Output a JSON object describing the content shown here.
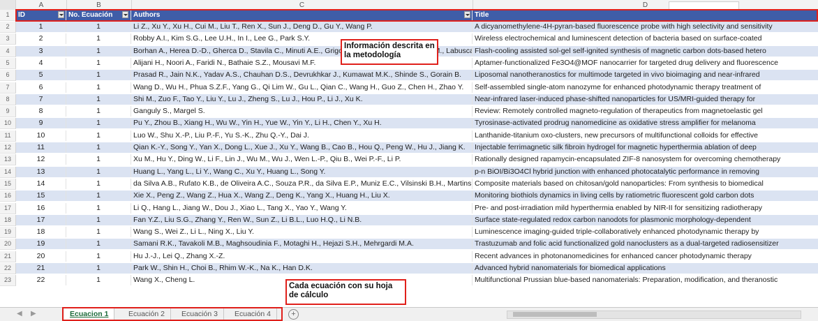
{
  "column_letters": [
    "A",
    "B",
    "C",
    "D"
  ],
  "name_box": "",
  "header": {
    "id": "ID",
    "no_ecuacion": "No. Ecuación",
    "authors": "Authors",
    "title": "Title"
  },
  "rows": [
    {
      "n": "2",
      "id": "1",
      "ne": "1",
      "authors": "Li Z., Xu Y., Xu H., Cui M., Liu T., Ren X., Sun J., Deng D., Gu Y., Wang P.",
      "title": "A dicyanomethylene-4H-pyran-based fluorescence probe with high selectivity and sensitivity"
    },
    {
      "n": "3",
      "id": "2",
      "ne": "1",
      "authors": "Robby A.I., Kim S.G., Lee U.H., In I., Lee G., Park S.Y.",
      "title": "Wireless electrochemical and luminescent detection of bacteria based on surface-coated"
    },
    {
      "n": "4",
      "id": "3",
      "ne": "1",
      "authors": "Borhan A., Herea D.-D., Gherca D., Stavila C., Minuti A.E., Grigoras M., Lupu N., Labusca C.M., Labusca L.",
      "title": "Flash-cooling assisted sol-gel self-ignited synthesis of magnetic carbon dots-based hetero"
    },
    {
      "n": "5",
      "id": "4",
      "ne": "1",
      "authors": "Alijani H., Noori A., Faridi N., Bathaie S.Z., Mousavi M.F.",
      "title": "Aptamer-functionalized Fe3O4@MOF nanocarrier for targeted drug delivery and fluorescence"
    },
    {
      "n": "6",
      "id": "5",
      "ne": "1",
      "authors": "Prasad R., Jain N.K., Yadav A.S., Chauhan D.S., Devrukhkar J., Kumawat M.K., Shinde S., Gorain B.",
      "title": "Liposomal nanotheranostics for multimode targeted in vivo bioimaging and near-infrared"
    },
    {
      "n": "7",
      "id": "6",
      "ne": "1",
      "authors": "Wang D., Wu H., Phua S.Z.F., Yang G., Qi Lim W., Gu L., Qian C., Wang H., Guo Z., Chen H., Zhao Y.",
      "title": "Self-assembled single-atom nanozyme for enhanced photodynamic therapy treatment of"
    },
    {
      "n": "8",
      "id": "7",
      "ne": "1",
      "authors": "Shi M., Zuo F., Tao Y., Liu Y., Lu J., Zheng S., Lu J., Hou P., Li J., Xu K.",
      "title": "Near-infrared laser-induced phase-shifted nanoparticles for US/MRI-guided therapy for"
    },
    {
      "n": "9",
      "id": "8",
      "ne": "1",
      "authors": "Ganguly S., Margel S.",
      "title": "Review: Remotely controlled magneto-regulation of therapeutics from magnetoelastic gel"
    },
    {
      "n": "10",
      "id": "9",
      "ne": "1",
      "authors": "Pu Y., Zhou B., Xiang H., Wu W., Yin H., Yue W., Yin Y., Li H., Chen Y., Xu H.",
      "title": "Tyrosinase-activated prodrug nanomedicine as oxidative stress amplifier for melanoma"
    },
    {
      "n": "11",
      "id": "10",
      "ne": "1",
      "authors": "Luo W., Shu X.-P., Liu P.-F., Yu S.-K., Zhu Q.-Y., Dai J.",
      "title": "Lanthanide-titanium oxo-clusters, new precursors of multifunctional colloids for effective"
    },
    {
      "n": "12",
      "id": "11",
      "ne": "1",
      "authors": "Qian K.-Y., Song Y., Yan X., Dong L., Xue J., Xu Y., Wang B., Cao B., Hou Q., Peng W., Hu J., Jiang K.",
      "title": "Injectable ferrimagnetic silk fibroin hydrogel for magnetic hyperthermia ablation of deep"
    },
    {
      "n": "13",
      "id": "12",
      "ne": "1",
      "authors": "Xu M., Hu Y., Ding W., Li F., Lin J., Wu M., Wu J., Wen L.-P., Qiu B., Wei P.-F., Li P.",
      "title": "Rationally designed rapamycin-encapsulated ZIF-8 nanosystem for overcoming chemotherapy"
    },
    {
      "n": "14",
      "id": "13",
      "ne": "1",
      "authors": "Huang L., Yang L., Li Y., Wang C., Xu Y., Huang L., Song Y.",
      "title": "p-n BiOI/Bi3O4Cl hybrid junction with enhanced photocatalytic performance in removing"
    },
    {
      "n": "15",
      "id": "14",
      "ne": "1",
      "authors": "da Silva A.B., Rufato K.B., de Oliveira A.C., Souza P.R., da Silva E.P., Muniz E.C., Vilsinski B.H., Martins A.F.",
      "title": "Composite materials based on chitosan/gold nanoparticles: From synthesis to biomedical"
    },
    {
      "n": "16",
      "id": "15",
      "ne": "1",
      "authors": "Xie X., Peng Z., Wang Z., Hua X., Wang Z., Deng K., Yang X., Huang H., Liu X.",
      "title": "Monitoring biothiols dynamics in living cells by ratiometric fluorescent gold carbon dots"
    },
    {
      "n": "17",
      "id": "16",
      "ne": "1",
      "authors": "Li Q., Hang L., Jiang W., Dou J., Xiao L., Tang X., Yao Y., Wang Y.",
      "title": "Pre- and post-irradiation mild hyperthermia enabled by NIR-II for sensitizing radiotherapy"
    },
    {
      "n": "18",
      "id": "17",
      "ne": "1",
      "authors": "Fan Y.Z., Liu S.G., Zhang Y., Ren W., Sun Z., Li B.L., Luo H.Q., Li N.B.",
      "title": "Surface state-regulated redox carbon nanodots for plasmonic morphology-dependent"
    },
    {
      "n": "19",
      "id": "18",
      "ne": "1",
      "authors": "Wang S., Wei Z., Li L., Ning X., Liu Y.",
      "title": "Luminescence imaging-guided triple-collaboratively enhanced photodynamic therapy by"
    },
    {
      "n": "20",
      "id": "19",
      "ne": "1",
      "authors": "Samani R.K., Tavakoli M.B., Maghsoudinia F., Motaghi H., Hejazi S.H., Mehrgardi M.A.",
      "title": "Trastuzumab and folic acid functionalized gold nanoclusters as a dual-targeted radiosensitizer"
    },
    {
      "n": "21",
      "id": "20",
      "ne": "1",
      "authors": "Hu J.-J., Lei Q., Zhang X.-Z.",
      "title": "Recent advances in photonanomedicines for enhanced cancer photodynamic therapy"
    },
    {
      "n": "22",
      "id": "21",
      "ne": "1",
      "authors": "Park W., Shin H., Choi B., Rhim W.-K., Na K., Han D.K.",
      "title": "Advanced hybrid nanomaterials for biomedical applications"
    },
    {
      "n": "23",
      "id": "22",
      "ne": "1",
      "authors": "Wang X., Cheng L.",
      "title": "Multifunctional Prussian blue-based nanomaterials: Preparation, modification, and theranostic"
    }
  ],
  "annotations": {
    "top": "Información descrita en la metodología",
    "bottom": "Cada ecuación con su hoja de cálculo"
  },
  "tabs": [
    "Ecuacion 1",
    "Ecuación 2",
    "Ecuación 3",
    "Ecuación 4"
  ],
  "active_tab": "Ecuacion 1",
  "add_sheet": "+",
  "colors": {
    "header_blue": "#3f5da8",
    "band": "#dbe3f2",
    "annotation_red": "#e0201b",
    "active_tab_green": "#1d6b3a"
  }
}
